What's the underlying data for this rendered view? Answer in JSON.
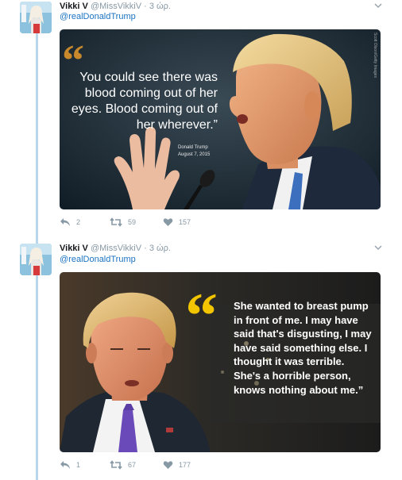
{
  "tweets": [
    {
      "name": "Vikki V",
      "handle": "@MissVikkiV",
      "time": "· 3 ώρ.",
      "reply_to": "@realDonaldTrump",
      "quote": "You could see there was blood coming out of her eyes. Blood coming out of her wherever.”",
      "citation_name": "Donald Trump",
      "citation_date": "August 7, 2015",
      "photo_credit": "Scott Olson/Getty Images",
      "replies": "2",
      "retweets": "59",
      "likes": "157"
    },
    {
      "name": "Vikki V",
      "handle": "@MissVikkiV",
      "time": "· 3 ώρ.",
      "reply_to": "@realDonaldTrump",
      "quote": "She wanted to breast pump in front of me. I may have said that's disgusting, I may have said something else. I thought it was terrible. She's a horrible person, knows nothing about me.”",
      "replies": "1",
      "retweets": "67",
      "likes": "177"
    }
  ],
  "colors": {
    "link": "#1b73c2",
    "muted": "#8899a6",
    "thread_line": "#b9d6ea",
    "quote_mark_1": "#c8892d",
    "quote_mark_2": "#f2c500"
  },
  "icons": [
    "avatar-icon",
    "caret-down-icon",
    "reply-icon",
    "retweet-icon",
    "like-icon"
  ]
}
